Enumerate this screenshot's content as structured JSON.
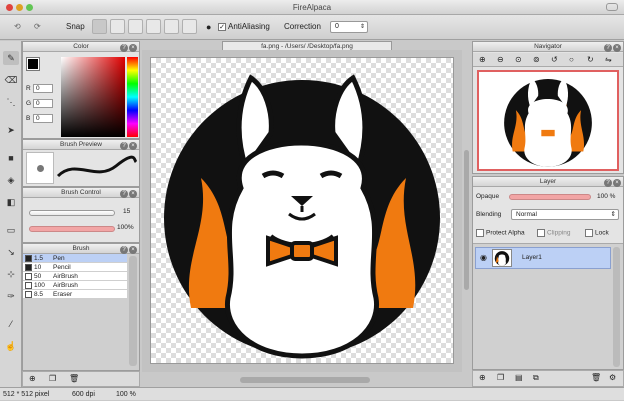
{
  "window": {
    "title": "FireAlpaca"
  },
  "toolbar": {
    "snap_label": "Snap",
    "antialias_label": "AntiAliasing",
    "antialias_check": "✓",
    "correction_label": "Correction",
    "correction_value": "0"
  },
  "document": {
    "tab_title": "fa.png - /Users/          /Desktop/fa.png"
  },
  "color_panel": {
    "title": "Color",
    "r_label": "R",
    "r_value": "0",
    "g_label": "G",
    "g_value": "0",
    "b_label": "B",
    "b_value": "0"
  },
  "brush_preview": {
    "title": "Brush Preview"
  },
  "brush_control": {
    "title": "Brush Control",
    "size_value": "15",
    "opacity_value": "100%"
  },
  "brush_panel": {
    "title": "Brush",
    "items": [
      {
        "size": "1.5",
        "name": "Pen",
        "color": "#222222"
      },
      {
        "size": "10",
        "name": "Pencil",
        "color": "#222222"
      },
      {
        "size": "50",
        "name": "AirBrush",
        "color": "#ffffff"
      },
      {
        "size": "100",
        "name": "AirBrush",
        "color": "#ffffff"
      },
      {
        "size": "8.5",
        "name": "Eraser",
        "color": "#ffffff"
      }
    ]
  },
  "navigator": {
    "title": "Navigator"
  },
  "layer_panel": {
    "title": "Layer",
    "opacity_label": "Opaque",
    "opacity_value": "100 %",
    "blending_label": "Blending",
    "blending_value": "Normal",
    "protect_alpha": "Protect Alpha",
    "clipping": "Clipping",
    "lock": "Lock",
    "layer_name": "Layer1"
  },
  "status": {
    "dimensions": "512 * 512 pixel",
    "dpi": "600 dpi",
    "zoom": "100 %"
  },
  "colors": {
    "accent_orange": "#f07a10",
    "selection_blue": "#bcd0f5",
    "slider_pink": "#f2a5a5"
  }
}
